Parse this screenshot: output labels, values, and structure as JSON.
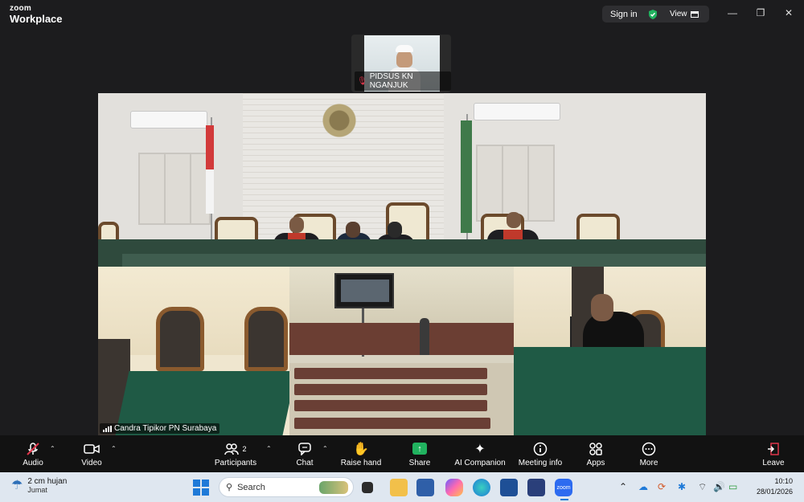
{
  "app": {
    "logo_line1": "zoom",
    "logo_line2": "Workplace",
    "sign_in": "Sign in",
    "view": "View"
  },
  "window_controls": {
    "minimize": "—",
    "restore": "❐",
    "close": "✕"
  },
  "thumbnail": {
    "name": "PIDSUS KN NGANJUK",
    "muted": true
  },
  "tiles": {
    "bottom_left_name": "Candra Tipikor PN Surabaya"
  },
  "toolbar": {
    "audio": "Audio",
    "video": "Video",
    "participants": "Participants",
    "participants_count": "2",
    "chat": "Chat",
    "raise_hand": "Raise hand",
    "share": "Share",
    "ai_companion": "AI Companion",
    "meeting_info": "Meeting info",
    "apps": "Apps",
    "more": "More",
    "leave": "Leave"
  },
  "taskbar": {
    "weather_line1": "2 cm hujan",
    "weather_line2": "Jumat",
    "search_placeholder": "Search",
    "zoom_app": "zoom",
    "time": "10:10",
    "date": "28/01/2026"
  },
  "colors": {
    "share_green": "#21b25f",
    "leave_red": "#e0354a",
    "verified_green": "#21b25f"
  }
}
